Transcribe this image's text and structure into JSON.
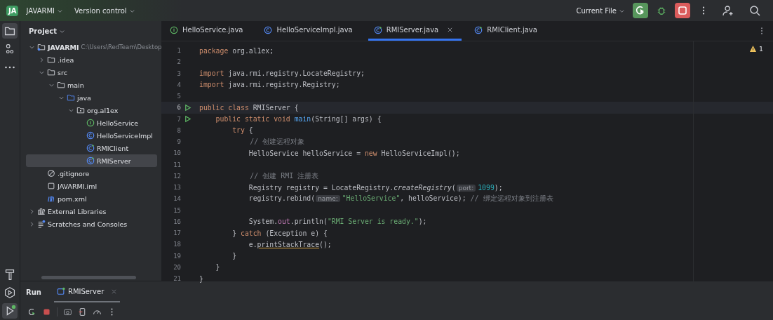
{
  "topbar": {
    "project_badge": "JA",
    "project": "JAVARMI",
    "vcs": "Version control",
    "run_config": "Current File"
  },
  "project_panel": {
    "title": "Project",
    "tree": [
      {
        "label": "JAVARMI",
        "path": "C:\\Users\\RedTeam\\Desktop",
        "kind": "project",
        "expanded": true,
        "selected": false,
        "children": [
          {
            "label": ".idea",
            "kind": "folder",
            "expanded": false,
            "selected": false
          },
          {
            "label": "src",
            "kind": "folder",
            "expanded": true,
            "selected": false,
            "children": [
              {
                "label": "main",
                "kind": "folder",
                "expanded": true,
                "selected": false,
                "children": [
                  {
                    "label": "java",
                    "kind": "source",
                    "expanded": true,
                    "selected": false,
                    "children": [
                      {
                        "label": "org.al1ex",
                        "kind": "package",
                        "expanded": true,
                        "selected": false,
                        "children": [
                          {
                            "label": "HelloService",
                            "kind": "interface",
                            "selected": false
                          },
                          {
                            "label": "HelloServiceImpl",
                            "kind": "class",
                            "selected": false
                          },
                          {
                            "label": "RMIClient",
                            "kind": "runnable",
                            "selected": false
                          },
                          {
                            "label": "RMIServer",
                            "kind": "runnable",
                            "selected": true
                          }
                        ]
                      }
                    ]
                  }
                ]
              }
            ]
          },
          {
            "label": ".gitignore",
            "kind": "ignore",
            "selected": false
          },
          {
            "label": "JAVARMI.iml",
            "kind": "iml",
            "selected": false
          },
          {
            "label": "pom.xml",
            "kind": "maven",
            "selected": false
          }
        ]
      },
      {
        "label": "External Libraries",
        "kind": "libraries",
        "expanded": false,
        "selected": false
      },
      {
        "label": "Scratches and Consoles",
        "kind": "scratches",
        "expanded": false,
        "selected": false
      }
    ]
  },
  "tabs": [
    {
      "label": "HelloService.java",
      "kind": "interface",
      "selected": false
    },
    {
      "label": "HelloServiceImpl.java",
      "kind": "class",
      "selected": false
    },
    {
      "label": "RMIServer.java",
      "kind": "runnable",
      "selected": true
    },
    {
      "label": "RMIClient.java",
      "kind": "runnable",
      "selected": false
    }
  ],
  "warnings": "1",
  "code": [
    {
      "n": "1",
      "run": false,
      "current": false,
      "tokens": [
        {
          "kind": "keyword",
          "text": "package "
        },
        {
          "kind": "plain",
          "text": "org.al1ex;"
        }
      ]
    },
    {
      "n": "2",
      "run": false,
      "current": false
    },
    {
      "n": "3",
      "run": false,
      "current": false,
      "tokens": [
        {
          "kind": "keyword",
          "text": "import "
        },
        {
          "kind": "plain",
          "text": "java.rmi.registry.LocateRegistry;"
        }
      ]
    },
    {
      "n": "4",
      "run": false,
      "current": false,
      "tokens": [
        {
          "kind": "keyword",
          "text": "import "
        },
        {
          "kind": "plain",
          "text": "java.rmi.registry.Registry;"
        }
      ]
    },
    {
      "n": "5",
      "run": false,
      "current": false
    },
    {
      "n": "6",
      "run": true,
      "current": true,
      "tokens": [
        {
          "kind": "keyword",
          "text": "public class "
        },
        {
          "kind": "plain",
          "text": "RMIServer {"
        }
      ]
    },
    {
      "n": "7",
      "run": true,
      "current": false,
      "tokens": [
        {
          "kind": "keyword",
          "text": "    public static void "
        },
        {
          "kind": "declaration",
          "text": "main"
        },
        {
          "kind": "plain",
          "text": "(String[] args) {"
        }
      ]
    },
    {
      "n": "8",
      "run": false,
      "current": false,
      "tokens": [
        {
          "kind": "keyword",
          "text": "        try "
        },
        {
          "kind": "plain",
          "text": "{"
        }
      ]
    },
    {
      "n": "9",
      "run": false,
      "current": false,
      "tokens": [
        {
          "kind": "comment",
          "text": "            // 创建远程对象"
        }
      ]
    },
    {
      "n": "10",
      "run": false,
      "current": false,
      "tokens": [
        {
          "kind": "plain",
          "text": "            HelloService helloService = "
        },
        {
          "kind": "keyword",
          "text": "new "
        },
        {
          "kind": "plain",
          "text": "HelloServiceImpl();"
        }
      ]
    },
    {
      "n": "11",
      "run": false,
      "current": false
    },
    {
      "n": "12",
      "run": false,
      "current": false,
      "tokens": [
        {
          "kind": "comment",
          "text": "            // 创建 RMI 注册表"
        }
      ]
    },
    {
      "n": "13",
      "run": false,
      "current": false,
      "tokens": [
        {
          "kind": "plain",
          "text": "            Registry registry = LocateRegistry."
        },
        {
          "kind": "static",
          "text": "createRegistry"
        },
        {
          "kind": "plain",
          "text": "("
        },
        {
          "kind": "hint",
          "text": "port:"
        },
        {
          "kind": "number",
          "text": "1099"
        },
        {
          "kind": "plain",
          "text": ");"
        }
      ]
    },
    {
      "n": "14",
      "run": false,
      "current": false,
      "tokens": [
        {
          "kind": "plain",
          "text": "            registry.rebind("
        },
        {
          "kind": "hint",
          "text": "name:"
        },
        {
          "kind": "string",
          "text": "\"HelloService\""
        },
        {
          "kind": "plain",
          "text": ", helloService); "
        },
        {
          "kind": "comment",
          "text": "// 绑定远程对象到注册表"
        }
      ]
    },
    {
      "n": "15",
      "run": false,
      "current": false
    },
    {
      "n": "16",
      "run": false,
      "current": false,
      "tokens": [
        {
          "kind": "plain",
          "text": "            System."
        },
        {
          "kind": "field",
          "text": "out"
        },
        {
          "kind": "plain",
          "text": ".println("
        },
        {
          "kind": "string",
          "text": "\"RMI Server is ready.\""
        },
        {
          "kind": "plain",
          "text": ");"
        }
      ]
    },
    {
      "n": "17",
      "run": false,
      "current": false,
      "tokens": [
        {
          "kind": "plain",
          "text": "        } "
        },
        {
          "kind": "keyword",
          "text": "catch "
        },
        {
          "kind": "plain",
          "text": "(Exception e) {"
        }
      ]
    },
    {
      "n": "18",
      "run": false,
      "current": false,
      "tokens": [
        {
          "kind": "plain",
          "text": "            e."
        },
        {
          "kind": "warning",
          "text": "printStackTrace"
        },
        {
          "kind": "plain",
          "text": "();"
        }
      ]
    },
    {
      "n": "19",
      "run": false,
      "current": false,
      "tokens": [
        {
          "kind": "plain",
          "text": "        }"
        }
      ]
    },
    {
      "n": "20",
      "run": false,
      "current": false,
      "tokens": [
        {
          "kind": "plain",
          "text": "    }"
        }
      ]
    },
    {
      "n": "21",
      "run": false,
      "current": false,
      "tokens": [
        {
          "kind": "plain",
          "text": "}"
        }
      ]
    }
  ],
  "run_panel": {
    "title": "Run",
    "tab": "RMIServer"
  }
}
